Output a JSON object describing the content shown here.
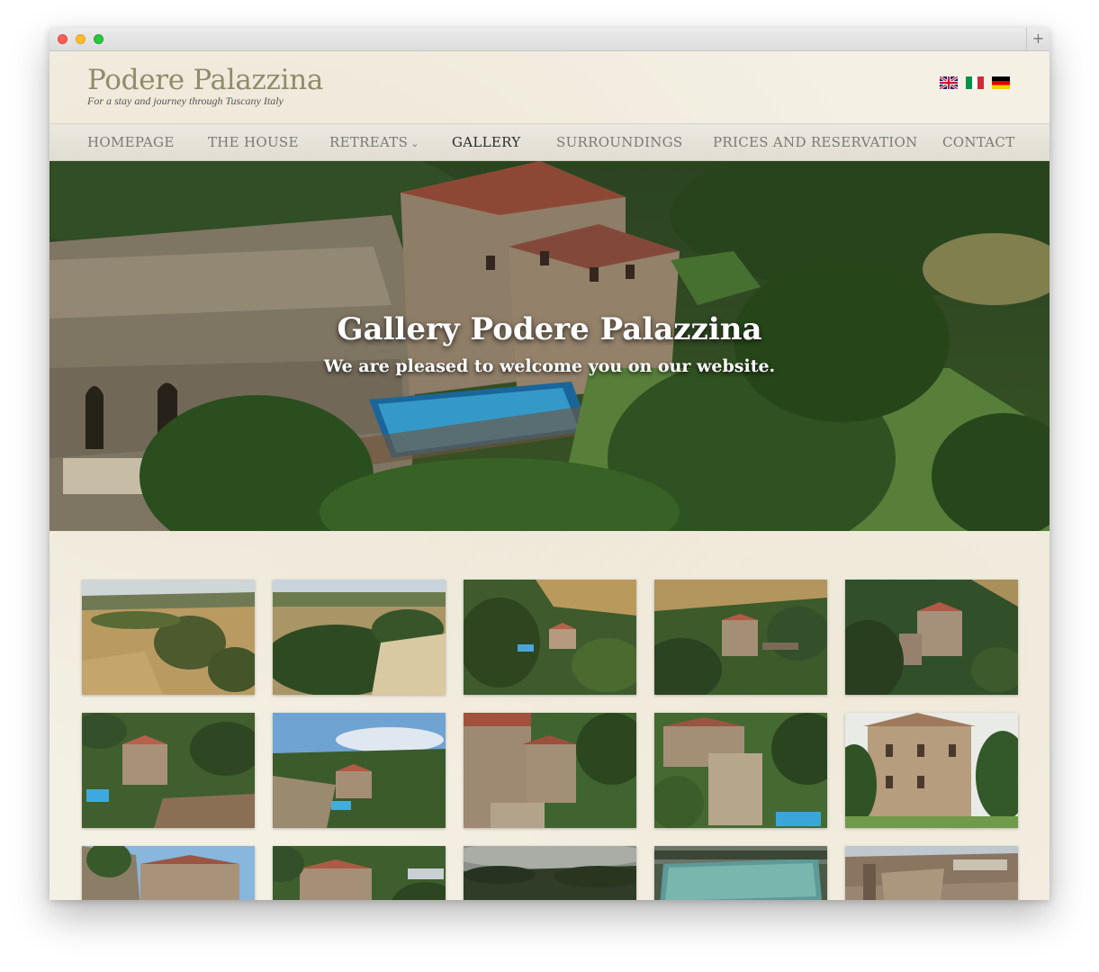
{
  "site": {
    "title": "Podere Palazzina",
    "tagline": "For a stay and journey through Tuscany Italy"
  },
  "languages": [
    {
      "name": "english-flag-icon"
    },
    {
      "name": "italian-flag-icon"
    },
    {
      "name": "german-flag-icon"
    }
  ],
  "nav": {
    "homepage": "HOMEPAGE",
    "the_house": "THE HOUSE",
    "retreats": "RETREATS",
    "gallery": "GALLERY",
    "surroundings": "SURROUNDINGS",
    "prices": "PRICES AND RESERVATION",
    "contact": "CONTACT",
    "active": "GALLERY"
  },
  "hero": {
    "title": "Gallery Podere Palazzina",
    "subtitle": "We are pleased to welcome you on our website."
  },
  "colors": {
    "accent_title": "#8d8d6b",
    "nav_text": "#7a7a74",
    "nav_active": "#2b2b2b",
    "page_bg": "#f4f0e4"
  },
  "gallery": {
    "photos": [
      {
        "scene": "fields-landscape"
      },
      {
        "scene": "fields-trees"
      },
      {
        "scene": "house-aerial-wide"
      },
      {
        "scene": "house-aerial-forest"
      },
      {
        "scene": "house-aerial-close"
      },
      {
        "scene": "house-pool-aerial"
      },
      {
        "scene": "house-sky-aerial"
      },
      {
        "scene": "house-facade-close"
      },
      {
        "scene": "house-pool-side"
      },
      {
        "scene": "house-front"
      },
      {
        "scene": "house-sky-low"
      },
      {
        "scene": "house-hill"
      },
      {
        "scene": "evening-landscape"
      },
      {
        "scene": "pool-evening"
      },
      {
        "scene": "rock-wall"
      }
    ]
  }
}
